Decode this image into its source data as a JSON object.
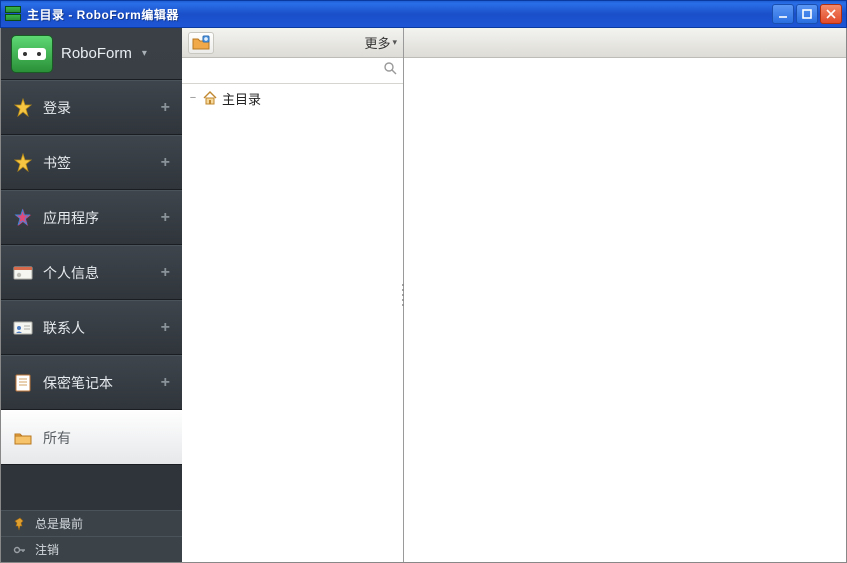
{
  "window": {
    "title": "主目录 - RoboForm编辑器"
  },
  "brand": {
    "name": "RoboForm"
  },
  "sidebar": {
    "items": [
      {
        "label": "登录",
        "icon": "star-key-icon"
      },
      {
        "label": "书签",
        "icon": "star-icon"
      },
      {
        "label": "应用程序",
        "icon": "star-multi-icon"
      },
      {
        "label": "个人信息",
        "icon": "id-card-icon"
      },
      {
        "label": "联系人",
        "icon": "contacts-icon"
      },
      {
        "label": "保密笔记本",
        "icon": "notepad-icon"
      },
      {
        "label": "所有",
        "icon": "folder-icon"
      }
    ]
  },
  "footer": {
    "always_on_top": "总是最前",
    "logout": "注销"
  },
  "toolbar": {
    "more_label": "更多"
  },
  "search": {
    "placeholder": ""
  },
  "tree": {
    "root_label": "主目录"
  },
  "colors": {
    "titlebar": "#1d55d6",
    "sidebar_bg": "#2e343a",
    "accent_green": "#2a9038"
  }
}
